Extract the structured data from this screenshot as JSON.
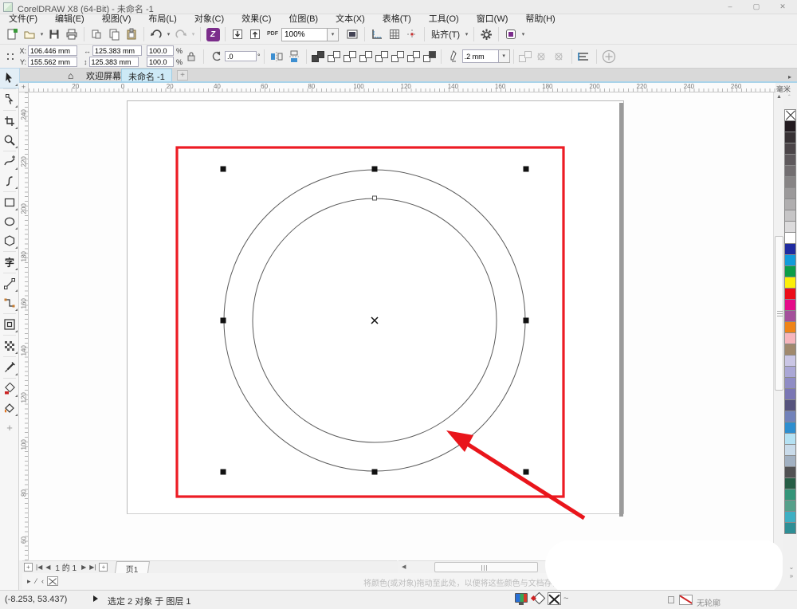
{
  "title_bar": {
    "title": "CorelDRAW X8 (64-Bit) - 未命名 -1",
    "minimize": "–",
    "maximize": "▢",
    "close": "✕"
  },
  "menu_bar": {
    "items": [
      "文件(F)",
      "编辑(E)",
      "视图(V)",
      "布局(L)",
      "对象(C)",
      "效果(C)",
      "位图(B)",
      "文本(X)",
      "表格(T)",
      "工具(O)",
      "窗口(W)",
      "帮助(H)"
    ]
  },
  "standard_toolbar": {
    "zoom_level": "100%",
    "pdf_label": "PDF",
    "snap_label": "贴齐(T)"
  },
  "property_bar": {
    "x_label": "X:",
    "x_value": "106.446 mm",
    "y_label": "Y:",
    "y_value": "155.562 mm",
    "width_value": "125.383 mm",
    "height_value": "125.383 mm",
    "scale_h": "100.0",
    "scale_v": "100.0",
    "percent": "%",
    "rotation_value": ".0",
    "degree": "°",
    "outline_width": ".2 mm"
  },
  "tab_bar": {
    "home_icon": "⌂",
    "welcome_tab": "欢迎屏幕",
    "document_tab": "未命名 -1",
    "new_tab_label": "+"
  },
  "rulers": {
    "unit": "毫米",
    "h_labels": [
      "20",
      "0",
      "20",
      "40",
      "60",
      "80",
      "100",
      "120",
      "140",
      "160",
      "180",
      "200",
      "220",
      "240",
      "260"
    ],
    "v_labels": [
      "240",
      "220",
      "200",
      "180",
      "160",
      "140",
      "120",
      "100",
      "80",
      "60"
    ]
  },
  "toolbox": {
    "tools": [
      "pick-tool",
      "shape-tool",
      "crop-tool",
      "zoom-tool",
      "freehand-tool",
      "bspline-tool",
      "rectangle-tool",
      "ellipse-tool",
      "polygon-tool",
      "text-tool",
      "dimension-tool",
      "connector-tool",
      "contour-tool",
      "transparency-tool",
      "eyedropper-tool",
      "interactive-fill-tool",
      "smart-fill-tool"
    ],
    "add_tools_label": "+"
  },
  "palette": {
    "colors": [
      "#231b20",
      "#373134",
      "#4b4548",
      "#5e595c",
      "#726e70",
      "#878485",
      "#9b999a",
      "#b0aeaf",
      "#c6c5c6",
      "#dcdbdc",
      "#ffffff",
      "#1f2ba0",
      "#129bda",
      "#0c9d48",
      "#fcee09",
      "#ec0c18",
      "#e50b89",
      "#a44f9b",
      "#ef8418",
      "#f6b5bc",
      "#a0896d",
      "#cac6e5",
      "#aaa7d6",
      "#8f8cc5",
      "#7a76b4",
      "#56537d",
      "#7282ba",
      "#2e8ecf",
      "#b4e1f3",
      "#c9dbea",
      "#a2b1c2",
      "#515153",
      "#265d45",
      "#349579",
      "#56a08a",
      "#3eafc3",
      "#2e8e95"
    ]
  },
  "page_nav": {
    "current_page": "1",
    "of_label": "的",
    "total_pages": "1",
    "page_tab": "页1"
  },
  "document_palette": {
    "hint": "将颜色(或对象)拖动至此处，以便将这些颜色与文档存储在一起"
  },
  "status_bar": {
    "coordinates": "(-8.253, 53.437)",
    "selection_info": "选定 2 对象 于 图层 1",
    "outline_text": "无轮廓"
  }
}
